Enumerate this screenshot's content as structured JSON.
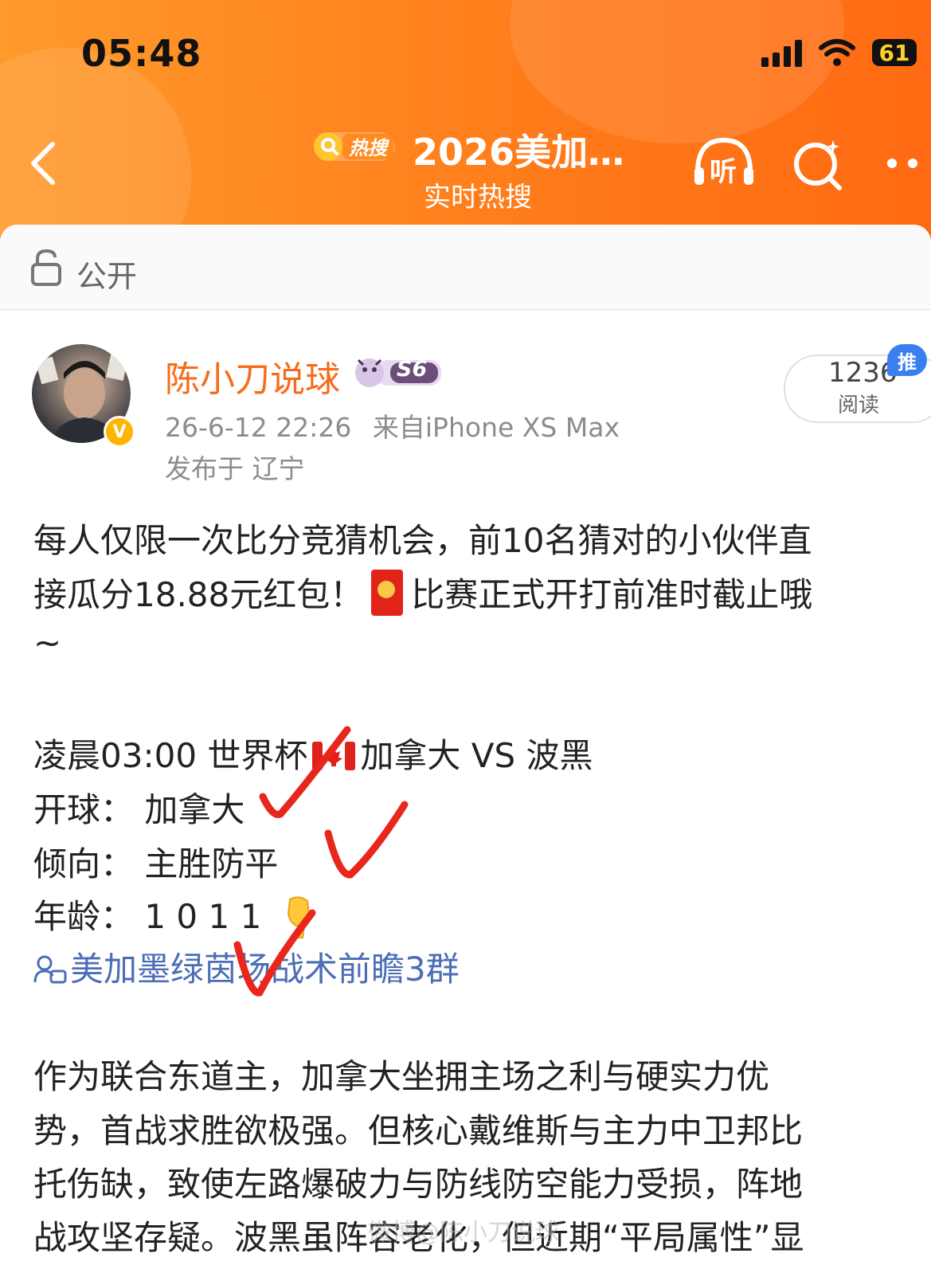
{
  "status_bar": {
    "time": "05:48",
    "battery": "61"
  },
  "header": {
    "hot_badge": "热搜",
    "title": "2026美加…",
    "subtitle": "实时热搜",
    "listen_label": "听"
  },
  "privacy": {
    "label": "公开"
  },
  "post": {
    "author": "陈小刀说球",
    "level": "S6",
    "verified_mark": "V",
    "time": "26-6-12 22:26",
    "source": "来自iPhone XS Max",
    "location": "发布于 辽宁",
    "reads_count": "1236",
    "reads_label": "阅读",
    "push_badge": "推",
    "lines": {
      "l1": "每人仅限一次比分竞猜机会，前10名猜对的小伙伴直",
      "l2a": "接瓜分18.88元红包！",
      "l2b": "比赛正式开打前准时截止哦",
      "l3": "~",
      "l4a": "凌晨03:00 世界杯",
      "l4b": "加拿大 VS 波黑",
      "l5": "开球：  加拿大",
      "l6": "倾向：  主胜防平",
      "l7": "年龄：  1 0  1 1",
      "group_link": "美加墨绿茵场战术前瞻3群",
      "l8": "作为联合东道主，加拿大坐拥主场之利与硬实力优",
      "l9": "势，首战求胜欲极强。但核心戴维斯与主力中卫邦比",
      "l10": "托伤缺，致使左路爆破力与防线防空能力受损，阵地",
      "l11": "战攻坚存疑。波黑虽阵容老化，但近期“平局属性”显"
    },
    "watermark": "微博@陈小刀说球"
  },
  "colors": {
    "header_orange": "#ff7a1a",
    "username": "#f76c1a",
    "link_blue": "#4c6eb6",
    "check_red": "#e8261c",
    "verified": "#ffb400"
  }
}
